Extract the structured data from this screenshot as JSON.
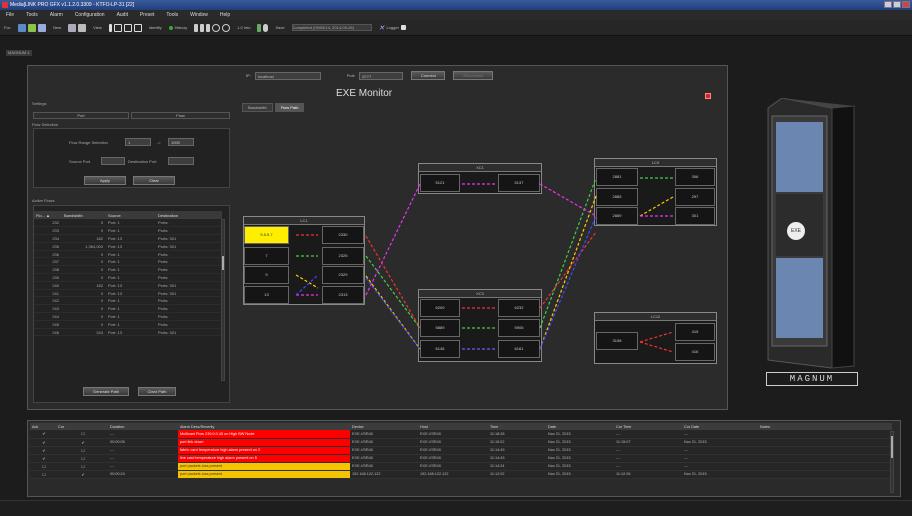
{
  "window": {
    "title": "Media[LINK PRO GFX v1.1.2.0.3309 - KTFO-LP-31 [22]"
  },
  "menu": [
    "File",
    "Tools",
    "Alarm",
    "Configuration",
    "Audit",
    "Preset",
    "Tools",
    "Window",
    "Help"
  ],
  "toolbar": {
    "label_for": "For:",
    "new_label": "New",
    "view_label": "View",
    "identify_label": "Identify",
    "history_label": "History",
    "search_placeholder": "",
    "level_label": "1.0 Info",
    "save_label": "Save",
    "completed_text": "Completed (09/09/14, 2014-09-26)",
    "logger_label": "Logger"
  },
  "doc_tab": "MAGNUM 1",
  "connection": {
    "ip_label": "IP:",
    "ip_value": "localhost",
    "port_label": "Port:",
    "port_value": "8777",
    "connect_label": "Connect",
    "disconnect_label": "Disconnect"
  },
  "title": "EXE Monitor",
  "tabs": [
    {
      "label": "Bandwidth"
    },
    {
      "label": "Flow Path"
    }
  ],
  "settings": {
    "title": "Settings",
    "port_tab": "Port",
    "flow_tab": "Flow",
    "flow_selection_title": "Flow Selection",
    "range_label": "Flow Range Selection",
    "range_from": "1",
    "range_sep": "->",
    "range_to": "1000",
    "source_port_label": "Source Port",
    "dest_port_label": "Destination Port",
    "apply_label": "Apply",
    "clear_label": "Clear",
    "active_flows_title": "Active Flows",
    "generate_label": "Generate Path",
    "clear_path_label": "Clear Path"
  },
  "flows": {
    "headers": [
      "Flo... ▲",
      "Bandwidth",
      "Source",
      "Destination"
    ],
    "rows": [
      [
        "232",
        "0",
        "Port: 1",
        "Ports:"
      ],
      [
        "233",
        "0",
        "Port: 1",
        "Ports:"
      ],
      [
        "234",
        "182",
        "Port: 13",
        "Ports: 301"
      ],
      [
        "235",
        "1,364,000",
        "Port: 13",
        "Ports: 301"
      ],
      [
        "236",
        "0",
        "Port: 1",
        "Ports:"
      ],
      [
        "237",
        "0",
        "Port: 1",
        "Ports:"
      ],
      [
        "238",
        "0",
        "Port: 1",
        "Ports:"
      ],
      [
        "239",
        "0",
        "Port: 1",
        "Ports:"
      ],
      [
        "240",
        "182",
        "Port: 13",
        "Ports: 301"
      ],
      [
        "241",
        "0",
        "Port: 13",
        "Ports: 301"
      ],
      [
        "242",
        "0",
        "Port: 1",
        "Ports:"
      ],
      [
        "243",
        "0",
        "Port: 1",
        "Ports:"
      ],
      [
        "244",
        "0",
        "Port: 1",
        "Ports:"
      ],
      [
        "245",
        "0",
        "Port: 1",
        "Ports:"
      ],
      [
        "246",
        "243",
        "Port: 13",
        "Ports: 301"
      ]
    ]
  },
  "diagram": {
    "lc1": {
      "title": "LC1",
      "cells": [
        "5.5.5.7",
        "2330",
        "7",
        "2325",
        "9",
        "2329",
        "13",
        "2313"
      ]
    },
    "xc1": {
      "title": "XC1",
      "cells": [
        "5121",
        "5137"
      ]
    },
    "xc3": {
      "title": "XC3",
      "cells": [
        "6209",
        "6232",
        "5889",
        "5905",
        "6145",
        "6161"
      ]
    },
    "lc9": {
      "title": "LC9",
      "cells": [
        "2881",
        "306",
        "2885",
        "297",
        "2889",
        "301"
      ]
    },
    "lc12": {
      "title": "LC12",
      "cells": [
        "3158",
        "415",
        "416"
      ]
    }
  },
  "cabinet": {
    "badge": "EXE",
    "brand": "MAGNUM"
  },
  "alarms": {
    "headers": [
      "Ack",
      "Cor",
      "Duration",
      "Alarm Desc/Severity",
      "Device",
      "Host",
      "Time",
      "Date",
      "Cor Time",
      "Cor Date",
      "Notes"
    ],
    "rows": [
      {
        "ack": "✔",
        "cor": "☐",
        "duration": "---",
        "desc": "Multicast Flow 239.0.0.45 on High BW Node",
        "sev": "red",
        "device": "EXE-VSR40",
        "host": "EXE-VSR40",
        "time": "11:18:28",
        "date": "Nov 21, 2015",
        "cor_time": "---",
        "cor_date": "---",
        "notes": ""
      },
      {
        "ack": "✔",
        "cor": "✔",
        "duration": "00:00:05",
        "desc": "port link down",
        "sev": "red",
        "device": "EXE-VSR40",
        "host": "EXE-VSR40",
        "time": "11:15:02",
        "date": "Nov 21, 2015",
        "cor_time": "11:15:07",
        "cor_date": "Nov 21, 2015",
        "notes": ""
      },
      {
        "ack": "✔",
        "cor": "☐",
        "duration": "---",
        "desc": "fabric card temperature high alarm present on 2",
        "sev": "red",
        "device": "EXE-VSR40",
        "host": "EXE-VSR40",
        "time": "11:14:49",
        "date": "Nov 21, 2015",
        "cor_time": "---",
        "cor_date": "---",
        "notes": ""
      },
      {
        "ack": "✔",
        "cor": "☐",
        "duration": "---",
        "desc": "line card temperature high alarm present on 5",
        "sev": "red",
        "device": "EXE-VSR40",
        "host": "EXE-VSR40",
        "time": "11:14:43",
        "date": "Nov 21, 2015",
        "cor_time": "---",
        "cor_date": "---",
        "notes": ""
      },
      {
        "ack": "☐",
        "cor": "☐",
        "duration": "---",
        "desc": "port packets loss present",
        "sev": "orange",
        "device": "EXE-VSR40",
        "host": "EXE-VSR40",
        "time": "11:14:24",
        "date": "Nov 21, 2015",
        "cor_time": "---",
        "cor_date": "---",
        "notes": ""
      },
      {
        "ack": "☐",
        "cor": "✔",
        "duration": "00:00:24",
        "desc": "port packets loss present",
        "sev": "orange",
        "device": "192.168.122.122",
        "host": "192.168.122.122",
        "time": "11:12:02",
        "date": "Nov 21, 2015",
        "cor_time": "11:12:26",
        "cor_date": "Nov 21, 2015",
        "notes": ""
      }
    ]
  }
}
